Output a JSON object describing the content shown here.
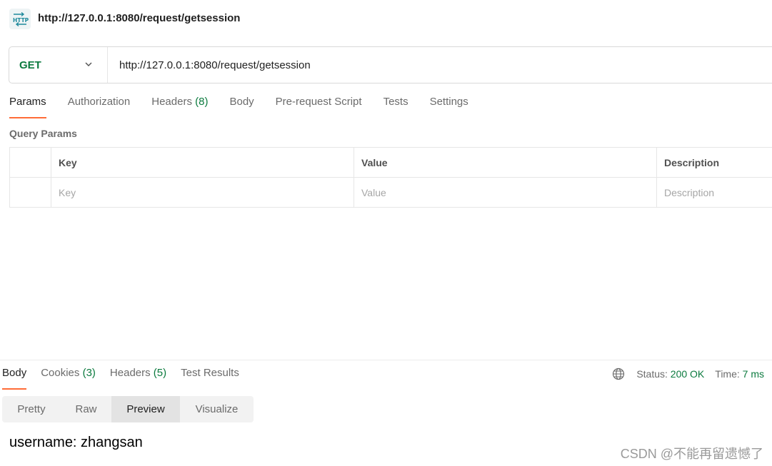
{
  "header": {
    "icon": "http-icon",
    "title": "http://127.0.0.1:8080/request/getsession"
  },
  "request": {
    "method": "GET",
    "url": "http://127.0.0.1:8080/request/getsession"
  },
  "request_tabs": [
    {
      "label": "Params",
      "count": ""
    },
    {
      "label": "Authorization",
      "count": ""
    },
    {
      "label": "Headers",
      "count": "(8)"
    },
    {
      "label": "Body",
      "count": ""
    },
    {
      "label": "Pre-request Script",
      "count": ""
    },
    {
      "label": "Tests",
      "count": ""
    },
    {
      "label": "Settings",
      "count": ""
    }
  ],
  "query_params": {
    "title": "Query Params",
    "columns": [
      "Key",
      "Value",
      "Description"
    ],
    "placeholders": {
      "key": "Key",
      "value": "Value",
      "description": "Description"
    }
  },
  "response_tabs": [
    {
      "label": "Body",
      "count": ""
    },
    {
      "label": "Cookies",
      "count": "(3)"
    },
    {
      "label": "Headers",
      "count": "(5)"
    },
    {
      "label": "Test Results",
      "count": ""
    }
  ],
  "status": {
    "status_label": "Status:",
    "status_value": "200 OK",
    "time_label": "Time:",
    "time_value": "7 ms"
  },
  "view_modes": [
    "Pretty",
    "Raw",
    "Preview",
    "Visualize"
  ],
  "response_body": "username: zhangsan",
  "watermark": "CSDN @不能再留遗憾了",
  "colors": {
    "accent": "#ff6c37",
    "success": "#0b7a3e"
  }
}
